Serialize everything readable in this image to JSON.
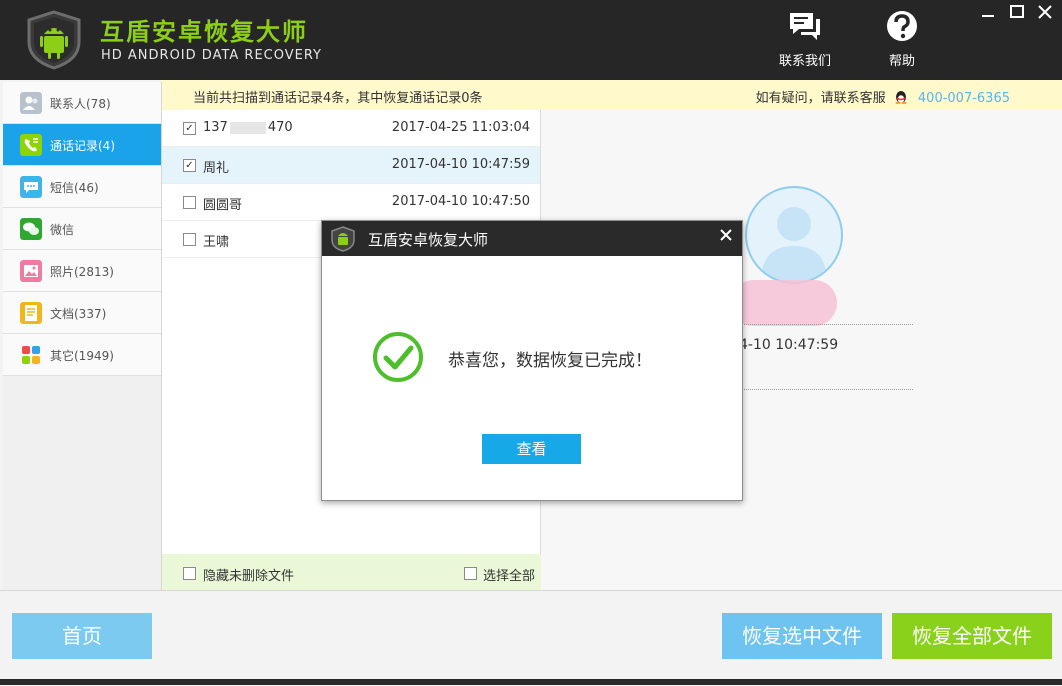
{
  "header": {
    "title": "互盾安卓恢复大师",
    "subtitle": "HD ANDROID DATA RECOVERY",
    "contact_label": "联系我们",
    "help_label": "帮助"
  },
  "infobar": {
    "scan_summary": "当前共扫描到通话记录4条，其中恢复通话记录0条",
    "support_text": "如有疑问，请联系客服",
    "phone": "400-007-6365"
  },
  "sidebar": {
    "items": [
      {
        "label": "联系人(78)"
      },
      {
        "label": "通话记录(4)"
      },
      {
        "label": "短信(46)"
      },
      {
        "label": "微信"
      },
      {
        "label": "照片(2813)"
      },
      {
        "label": "文档(337)"
      },
      {
        "label": "其它(1949)"
      }
    ]
  },
  "call_list": {
    "rows": [
      {
        "name_prefix": "137",
        "name_suffix": "470",
        "time": "2017-04-25 11:03:04",
        "checked": true
      },
      {
        "name": "周礼",
        "time": "2017-04-10 10:47:59",
        "checked": true
      },
      {
        "name": "圆圆哥",
        "time": "2017-04-10 10:47:50",
        "checked": false
      },
      {
        "name": "王啸",
        "checked": false
      }
    ],
    "check_mark": "✓",
    "hide_undeleted_label": "隐藏未删除文件",
    "select_all_label": "选择全部"
  },
  "detail": {
    "time_partial": "4-10 10:47:59"
  },
  "bottom": {
    "home_label": "首页",
    "recover_selected_label": "恢复选中文件",
    "recover_all_label": "恢复全部文件"
  },
  "dialog": {
    "title": "互盾安卓恢复大师",
    "message": "恭喜您，数据恢复已完成！",
    "view_label": "查看"
  },
  "colors": {
    "accent_blue": "#1aa3e8",
    "accent_green": "#8ad11c",
    "title_green": "#8ccf16"
  }
}
